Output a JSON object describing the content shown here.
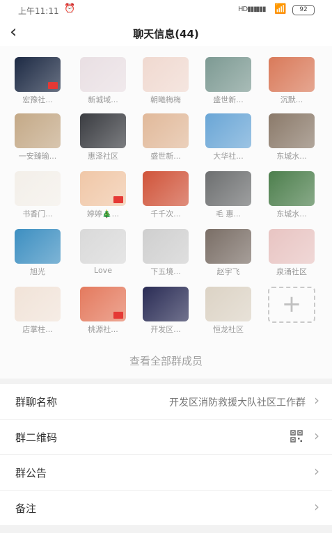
{
  "status": {
    "time": "上午11:11",
    "alarm": "⏰",
    "signal1": "HD▮▮▮",
    "signal2": "▮▮▮",
    "wifi": "📶",
    "battery": "92"
  },
  "nav": {
    "back": "‹",
    "title": "聊天信息(44)"
  },
  "members": [
    {
      "name": "宏豫社...",
      "color": "#1d2a44",
      "flag": true
    },
    {
      "name": "新城域...",
      "color": "#e9dfe3",
      "flag": false
    },
    {
      "name": "朝曦梅梅",
      "color": "#f0d9d0",
      "flag": false
    },
    {
      "name": "盛世新...",
      "color": "#7d9a93",
      "flag": false
    },
    {
      "name": "沉默...",
      "color": "#d97a5a",
      "flag": false
    },
    {
      "name": "一安臻瑜...",
      "color": "#c4a987",
      "flag": false
    },
    {
      "name": "惠泽社区",
      "color": "#3a3c41",
      "flag": false
    },
    {
      "name": "盛世新...",
      "color": "#e1b99a",
      "flag": false
    },
    {
      "name": "大华社...",
      "color": "#6aa6d6",
      "flag": false
    },
    {
      "name": "东城水...",
      "color": "#8b7a6a",
      "flag": false
    },
    {
      "name": "书香门...",
      "color": "#f3efe9",
      "flag": false
    },
    {
      "name": "婷婷🎄...",
      "color": "#f0c7a7",
      "flag": true
    },
    {
      "name": "千千次...",
      "color": "#d0543a",
      "flag": false
    },
    {
      "name": "毛 惠...",
      "color": "#6d6f70",
      "flag": false
    },
    {
      "name": "东城水...",
      "color": "#4d7f4d",
      "flag": false
    },
    {
      "name": "旭光",
      "color": "#3d8fc1",
      "flag": false
    },
    {
      "name": "Love",
      "color": "#d9d9d9",
      "flag": false
    },
    {
      "name": "下五境...",
      "color": "#cfcfcf",
      "flag": false
    },
    {
      "name": "赵宇飞",
      "color": "#7a6e66",
      "flag": false
    },
    {
      "name": "泉涌社区",
      "color": "#e8c4c2",
      "flag": false
    },
    {
      "name": "店掌柱...",
      "color": "#f1e3d8",
      "flag": false
    },
    {
      "name": "桃源社...",
      "color": "#e47a5e",
      "flag": true
    },
    {
      "name": "开发区...",
      "color": "#2a2c55",
      "flag": false
    },
    {
      "name": "恒龙社区",
      "color": "#dcd3c5",
      "flag": false
    }
  ],
  "add_symbol": "+",
  "view_all": "查看全部群成员",
  "settings": [
    {
      "label": "群聊名称",
      "value": "开发区消防救援大队社区工作群"
    },
    {
      "label": "群二维码",
      "value": ""
    },
    {
      "label": "群公告",
      "value": ""
    },
    {
      "label": "备注",
      "value": ""
    }
  ],
  "chevron": "›",
  "icons": {
    "back": "back-arrow-icon",
    "qr": "qr-code-icon",
    "chevron": "chevron-right-icon",
    "add": "add-member-icon"
  }
}
